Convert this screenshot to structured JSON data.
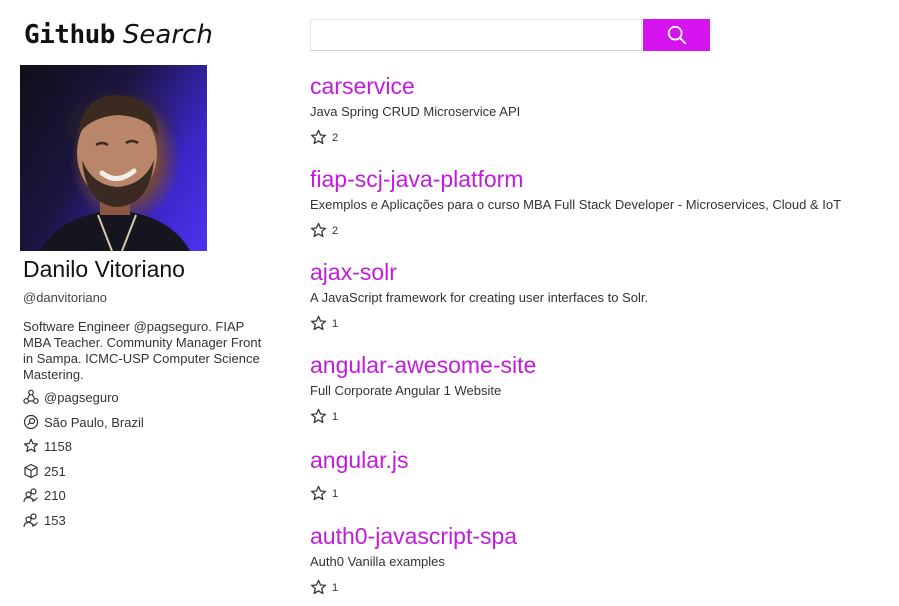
{
  "header": {
    "logo_main": "Github",
    "logo_sub": "Search"
  },
  "search": {
    "value": "",
    "placeholder": "",
    "button_icon": "search-icon"
  },
  "profile": {
    "avatar_alt": "",
    "name": "Danilo Vitoriano",
    "login": "@danvitoriano",
    "bio": "Software Engineer @pagseguro. FIAP MBA Teacher. Community Manager Front in Sampa. ICMC-USP Computer Science Mastering.",
    "company": "@pagseguro",
    "location": "São Paulo, Brazil",
    "stars": "1158",
    "repos": "251",
    "followers": "210",
    "following": "153"
  },
  "repos": [
    {
      "name": "carservice",
      "description": "Java Spring CRUD Microservice API",
      "stars": "2"
    },
    {
      "name": "fiap-scj-java-platform",
      "description": "Exemplos e Aplicações para o curso MBA Full Stack Developer - Microservices, Cloud & IoT",
      "stars": "2"
    },
    {
      "name": "ajax-solr",
      "description": "A JavaScript framework for creating user interfaces to Solr.",
      "stars": "1"
    },
    {
      "name": "angular-awesome-site",
      "description": "Full Corporate Angular 1 Website",
      "stars": "1"
    },
    {
      "name": "angular.js",
      "description": "",
      "stars": "1"
    },
    {
      "name": "auth0-javascript-spa",
      "description": "Auth0 Vanilla examples",
      "stars": "1"
    }
  ],
  "colors": {
    "accent": "#d514f0",
    "repo_link": "#c21bde"
  }
}
